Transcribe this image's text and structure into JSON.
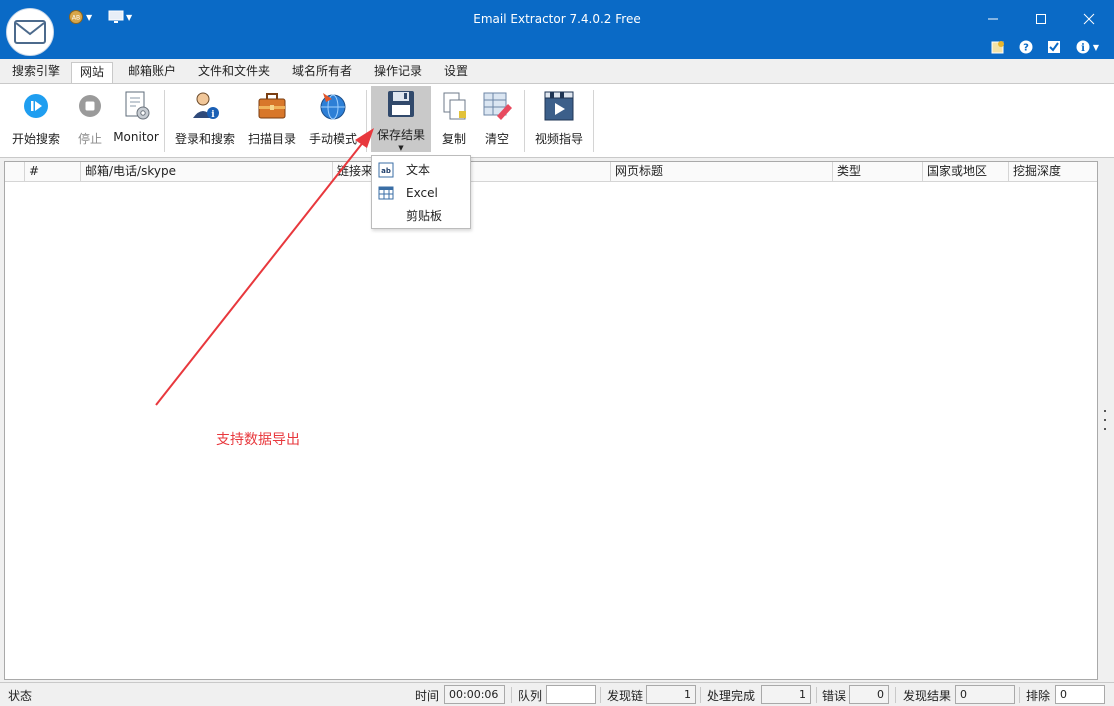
{
  "window": {
    "title": "Email Extractor 7.4.0.2 Free",
    "minimize_icon": "minimize-icon",
    "maximize_icon": "maximize-icon",
    "close_icon": "close-icon"
  },
  "tabs": [
    {
      "label": "搜索引擎"
    },
    {
      "label": "网站"
    },
    {
      "label": "邮箱账户"
    },
    {
      "label": "文件和文件夹"
    },
    {
      "label": "域名所有者"
    },
    {
      "label": "操作记录"
    },
    {
      "label": "设置"
    }
  ],
  "ribbon": {
    "start": "开始搜索",
    "stop": "停止",
    "monitor": "Monitor",
    "login_search": "登录和搜索",
    "scan_dir": "扫描目录",
    "manual": "手动模式",
    "save": "保存结果",
    "copy": "复制",
    "clear": "清空",
    "video": "视频指导"
  },
  "save_menu": {
    "text": "文本",
    "excel": "Excel",
    "clipboard": "剪贴板"
  },
  "grid": {
    "columns": [
      "#",
      "邮箱/电话/skype",
      "链接来源",
      "网页标题",
      "类型",
      "国家或地区",
      "挖掘深度"
    ]
  },
  "annotation": "支持数据导出",
  "status": {
    "state_label": "状态",
    "time_label": "时间",
    "time_value": "00:00:06",
    "queue_label": "队列",
    "queue_value": "",
    "found_links_label": "发现链",
    "found_links_value": "1",
    "processed_label": "处理完成",
    "processed_value": "1",
    "errors_label": "错误",
    "errors_value": "0",
    "results_label": "发现结果",
    "results_value": "0",
    "excluded_label": "排除",
    "excluded_value": "0"
  },
  "colors": {
    "titlebar": "#0a6ac6",
    "annotation": "#e8383d"
  }
}
